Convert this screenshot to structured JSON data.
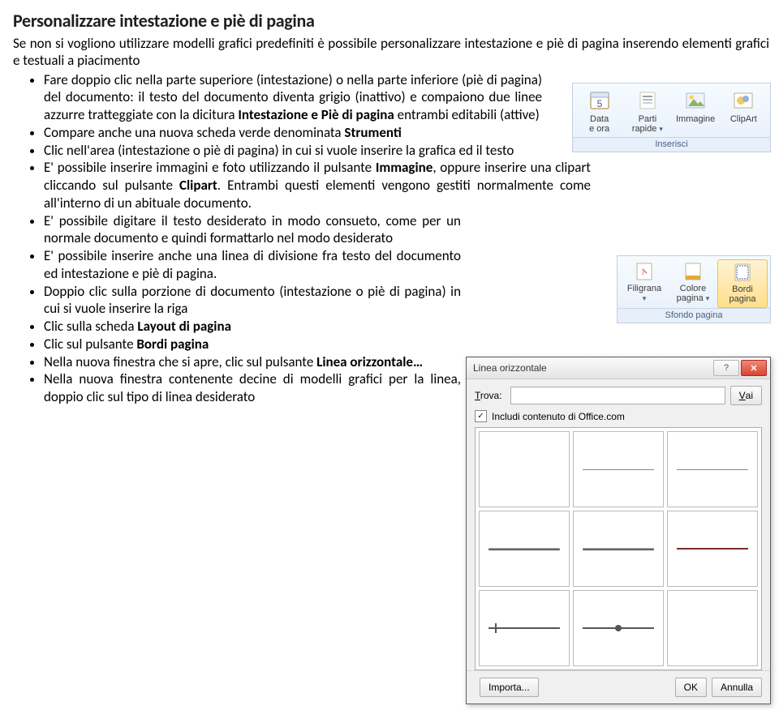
{
  "doc": {
    "heading": "Personalizzare intestazione e piè di pagina",
    "intro": "Se non si vogliono utilizzare modelli grafici predefiniti è possibile personalizzare intestazione e piè di pagina inserendo elementi grafici e testuali a piacimento",
    "bullets": [
      {
        "t1": "Fare doppio clic nella parte superiore (intestazione) o nella parte inferiore (piè di pagina) del documento: il testo del documento diventa grigio (inattivo) e compaiono due linee azzurre tratteggiate con la dicitura ",
        "b1": "Intestazione e Piè di pagina",
        "t2": " entrambi editabili (attive)"
      },
      {
        "t1": "Compare anche una nuova scheda verde denominata ",
        "b1": "Strumenti",
        "t2": ""
      },
      {
        "t1": "Clic nell'area (intestazione o piè di pagina) in cui si vuole inserire la grafica ed il testo"
      },
      {
        "t1": "E' possibile inserire immagini e foto utilizzando il pulsante ",
        "b1": "Immagine",
        "t2": ", oppure inserire una clipart cliccando sul pulsante ",
        "b2": "Clipart",
        "t3": ". Entrambi questi elementi vengono gestiti normalmente come all'interno di un abituale documento."
      },
      {
        "t1": "E' possibile digitare il testo desiderato in modo consueto, come per un normale documento e quindi formattarlo nel modo desiderato"
      },
      {
        "t1": "E' possibile inserire anche una linea di divisione fra testo del documento ed intestazione e piè di pagina."
      },
      {
        "t1": "Doppio clic sulla porzione di documento (intestazione o piè di pagina) in cui si vuole inserire la riga"
      },
      {
        "t1": "Clic sulla scheda ",
        "b1": "Layout di pagina",
        "t2": ""
      },
      {
        "t1": "Clic sul pulsante ",
        "b1": "Bordi pagina",
        "t2": ""
      },
      {
        "t1": "Nella nuova finestra che si apre, clic sul pulsante ",
        "b1": "Linea orizzontale…",
        "t2": ""
      },
      {
        "t1": "Nella nuova finestra contenente decine di modelli grafici per la linea, doppio clic sul tipo di linea desiderato"
      }
    ]
  },
  "ribbon_inserisci": {
    "group_label": "Inserisci",
    "items": [
      {
        "label": "Data\ne ora",
        "icon": "calendar-icon"
      },
      {
        "label": "Parti\nrapide",
        "icon": "quickparts-icon",
        "dd": true
      },
      {
        "label": "Immagine",
        "icon": "picture-icon"
      },
      {
        "label": "ClipArt",
        "icon": "clipart-icon"
      }
    ]
  },
  "ribbon_sfondo": {
    "group_label": "Sfondo pagina",
    "items": [
      {
        "label": "Filigrana",
        "icon": "watermark-icon",
        "dd": true
      },
      {
        "label": "Colore\npagina",
        "icon": "pagecolor-icon",
        "dd": true
      },
      {
        "label": "Bordi\npagina",
        "icon": "pageborders-icon",
        "selected": true
      }
    ]
  },
  "dialog": {
    "title": "Linea orizzontale",
    "find_label": "Trova:",
    "find_value": "",
    "go_label": "Vai",
    "include_label": "Includi contenuto di Office.com",
    "include_checked": true,
    "buttons": {
      "import": "Importa...",
      "ok": "OK",
      "cancel": "Annulla"
    }
  }
}
